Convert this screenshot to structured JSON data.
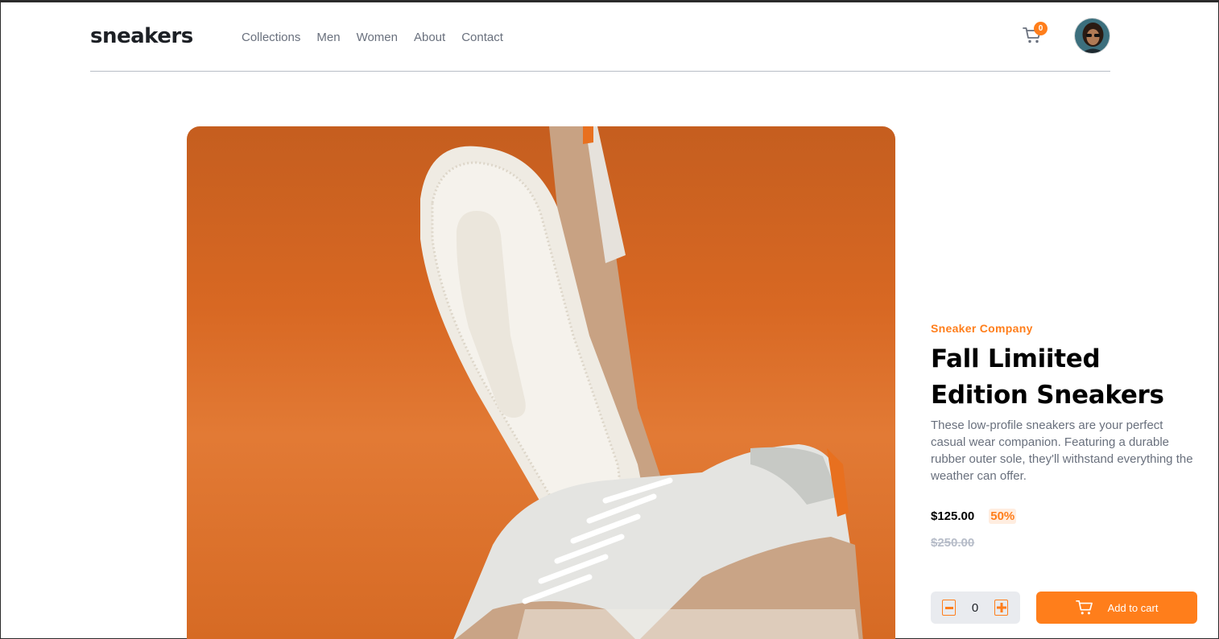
{
  "header": {
    "logo": "sneakers",
    "nav": [
      "Collections",
      "Men",
      "Women",
      "About",
      "Contact"
    ],
    "cart_count": "0",
    "icons": {
      "cart": "cart-icon",
      "avatar": "avatar"
    }
  },
  "product": {
    "company": "Sneaker Company",
    "title": "Fall Limiited Edition Sneakers",
    "description": "These low-profile sneakers are your perfect casual wear companion. Featuring a durable rubber outer sole, they'll withstand everything the weather can offer.",
    "price": "$125.00",
    "discount": "50%",
    "original_price": "$250.00",
    "quantity": "0",
    "add_to_cart_label": "Add to cart"
  },
  "colors": {
    "accent": "#ff7e1b",
    "accent_light": "#ffede0",
    "text_dark": "#1d2025",
    "text_muted": "#69707d",
    "old_price": "#b6bcc8"
  }
}
